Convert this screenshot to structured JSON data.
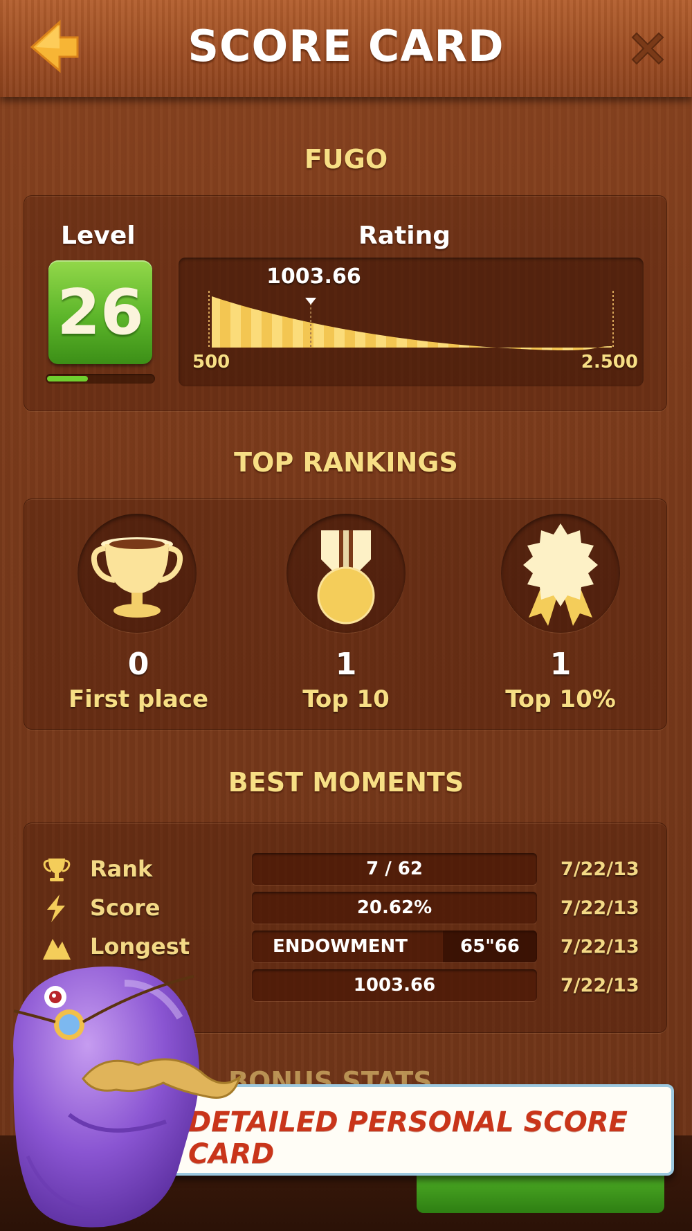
{
  "header": {
    "title": "SCORE CARD"
  },
  "profile": {
    "game_name": "FUGO",
    "level_label": "Level",
    "level_value": "26",
    "level_progress": 0.38,
    "rating_label": "Rating",
    "rating_value": "1003.66",
    "rating_min": "500",
    "rating_max": "2.500",
    "rating_numeric": {
      "value": 1003.66,
      "min": 500,
      "max": 2500
    }
  },
  "top_rankings": {
    "title": "TOP RANKINGS",
    "items": [
      {
        "icon": "trophy-icon",
        "count": "0",
        "label": "First place"
      },
      {
        "icon": "medal-icon",
        "count": "1",
        "label": "Top 10"
      },
      {
        "icon": "rosette-icon",
        "count": "1",
        "label": "Top 10%"
      }
    ]
  },
  "best_moments": {
    "title": "BEST MOMENTS",
    "rows": [
      {
        "icon": "trophy-icon",
        "label": "Rank",
        "value": "7 / 62",
        "date": "7/22/13"
      },
      {
        "icon": "lightning-icon",
        "label": "Score",
        "value": "20.62%",
        "date": "7/22/13"
      },
      {
        "icon": "mountain-icon",
        "label": "Longest",
        "word": "ENDOWMENT",
        "time": "65\"66",
        "date": "7/22/13"
      },
      {
        "icon": "",
        "label": "",
        "value": "1003.66",
        "date": "7/22/13"
      }
    ]
  },
  "bonus_stats": {
    "title": "BONUS STATS"
  },
  "promo": {
    "banner": "DETAILED PERSONAL SCORE CARD"
  },
  "colors": {
    "accent_yellow": "#f7df85",
    "level_green": "#5cb52a",
    "banner_red": "#c9351a"
  }
}
